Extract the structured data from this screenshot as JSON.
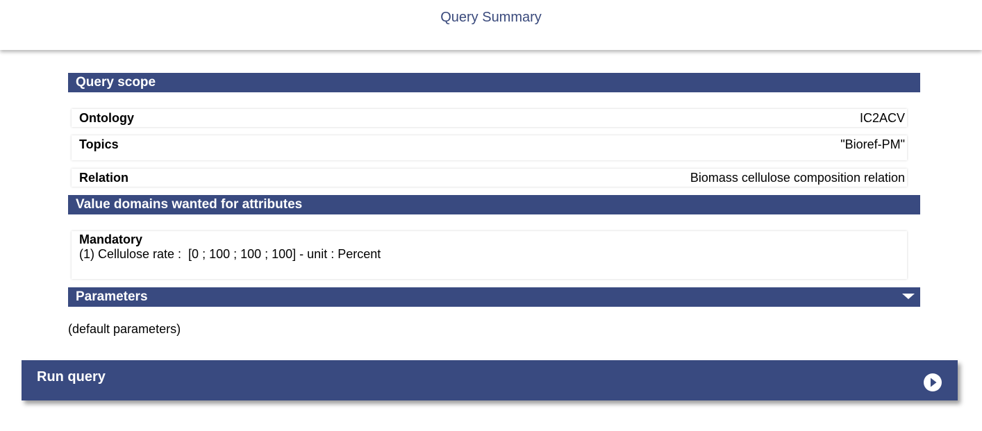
{
  "header": {
    "title": "Query Summary"
  },
  "scope": {
    "title": "Query scope",
    "rows": [
      {
        "label": "Ontology",
        "value": "IC2ACV"
      },
      {
        "label": "Topics",
        "value": "\"Bioref-PM\""
      },
      {
        "label": "Relation",
        "value": "Biomass cellulose composition relation"
      }
    ]
  },
  "domains": {
    "title": "Value domains wanted for attributes",
    "mandatory_label": "Mandatory",
    "mandatory_text": "(1) Cellulose rate :  [0 ; 100 ; 100 ; 100] - unit : Percent"
  },
  "parameters": {
    "title": "Parameters",
    "icon": "triangle-down-icon",
    "text": "(default parameters)"
  },
  "run": {
    "label": "Run query",
    "icon": "play-circle-icon"
  },
  "colors": {
    "accent": "#394a80",
    "title_text": "#3a4a7c"
  }
}
